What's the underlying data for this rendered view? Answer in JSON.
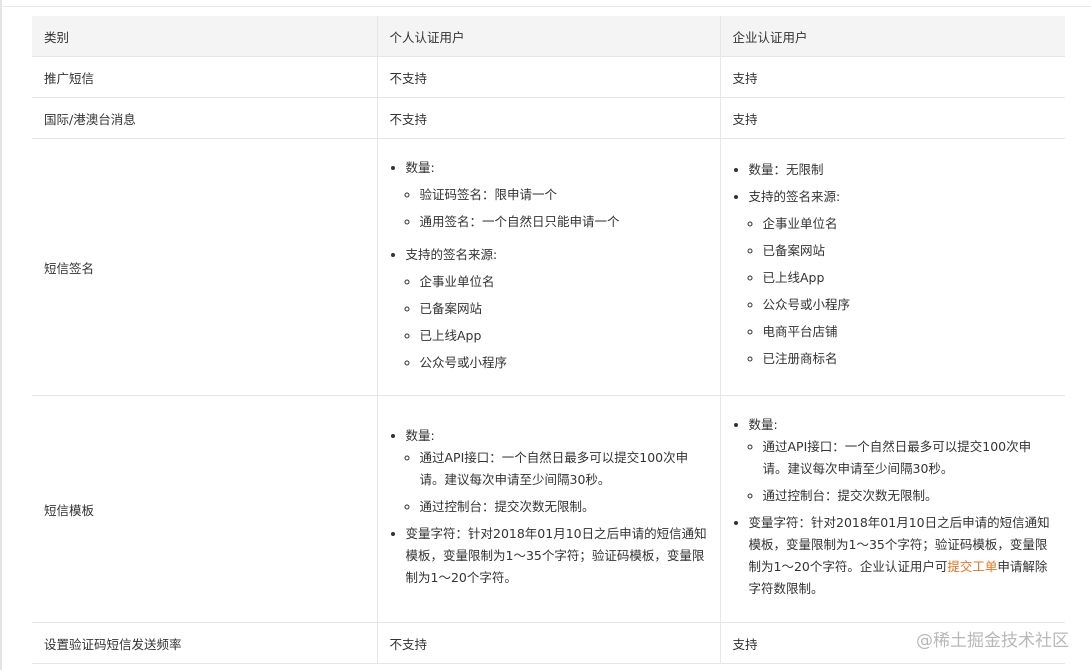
{
  "headers": [
    "类别",
    "个人认证用户",
    "企业认证用户"
  ],
  "rows": {
    "promo": {
      "category": "推广短信",
      "personal": "不支持",
      "enterprise": "支持"
    },
    "intl": {
      "category": "国际/港澳台消息",
      "personal": "不支持",
      "enterprise": "支持"
    },
    "signature": {
      "category": "短信签名",
      "personal": {
        "quantity": "数量:",
        "quantity_items": [
          "验证码签名：限申请一个",
          "通用签名：一个自然日只能申请一个"
        ],
        "sources": "支持的签名来源:",
        "source_items": [
          "企事业单位名",
          "已备案网站",
          "已上线App",
          "公众号或小程序"
        ]
      },
      "enterprise": {
        "quantity": "数量：无限制",
        "sources": "支持的签名来源:",
        "source_items": [
          "企事业单位名",
          "已备案网站",
          "已上线App",
          "公众号或小程序",
          "电商平台店铺",
          "已注册商标名"
        ]
      }
    },
    "template": {
      "category": "短信模板",
      "personal": {
        "quantity": "数量:",
        "quantity_items": [
          "通过API接口：一个自然日最多可以提交100次申请。建议每次申请至少间隔30秒。",
          "通过控制台：提交次数无限制。"
        ],
        "variable": "变量字符：针对2018年01月10日之后申请的短信通知模板，变量限制为1～35个字符；验证码模板，变量限制为1～20个字符。"
      },
      "enterprise": {
        "quantity": "数量:",
        "quantity_items": [
          "通过API接口：一个自然日最多可以提交100次申请。建议每次申请至少间隔30秒。",
          "通过控制台：提交次数无限制。"
        ],
        "variable_pre": "变量字符：针对2018年01月10日之后申请的短信通知模板，变量限制为1～35个字符；验证码模板，变量限制为1～20个字符。企业认证用户可",
        "variable_link": "提交工单",
        "variable_post": "申请解除字符数限制。"
      }
    },
    "frequency": {
      "category": "设置验证码短信发送频率",
      "personal": "不支持",
      "enterprise": "支持"
    }
  },
  "watermark": "@稀土掘金技术社区",
  "colors": {
    "link": "#e6751f",
    "header_bg": "#f4f4f4",
    "border": "#e6e6e6"
  }
}
